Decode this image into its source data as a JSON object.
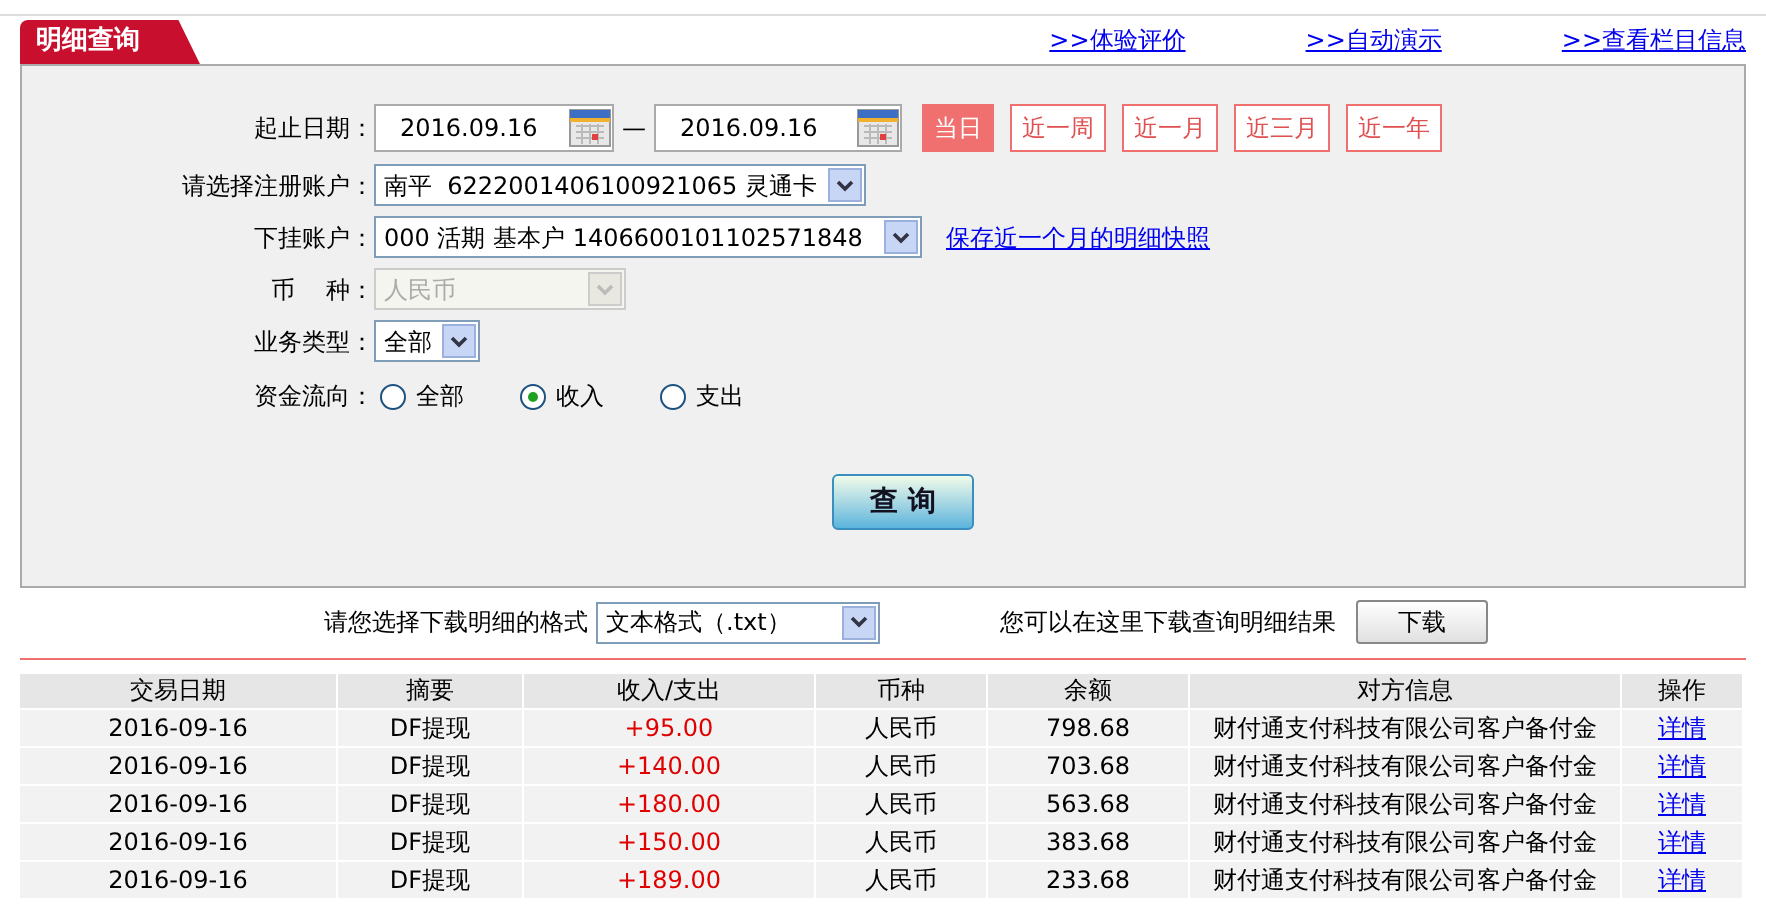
{
  "header": {
    "tab": "明细查询",
    "links": [
      ">>体验评价",
      ">>自动演示",
      ">>查看栏目信息"
    ]
  },
  "form": {
    "date_label": "起止日期：",
    "start_date": "2016.09.16",
    "separator": "—",
    "end_date": "2016.09.16",
    "quick_ranges": [
      {
        "label": "当日",
        "selected": true
      },
      {
        "label": "近一周",
        "selected": false
      },
      {
        "label": "近一月",
        "selected": false
      },
      {
        "label": "近三月",
        "selected": false
      },
      {
        "label": "近一年",
        "selected": false
      }
    ],
    "account": {
      "label": "请选择注册账户：",
      "value": "南平  6222001406100921065 灵通卡",
      "disabled": false
    },
    "sub_account": {
      "label": "下挂账户：",
      "value": "000 活期 基本户 1406600101102571848",
      "disabled": false,
      "link": "保存近一个月的明细快照"
    },
    "currency": {
      "label": "币    种：",
      "value": "人民币",
      "disabled": true
    },
    "business_type": {
      "label": "业务类型：",
      "value": "全部",
      "disabled": false
    },
    "flow": {
      "label": "资金流向：",
      "options": [
        {
          "label": "全部",
          "selected": false
        },
        {
          "label": "收入",
          "selected": true
        },
        {
          "label": "支出",
          "selected": false
        }
      ]
    },
    "query_button": "查 询"
  },
  "download": {
    "label": "请您选择下载明细的格式",
    "format": "文本格式（.txt）",
    "hint": "您可以在这里下载查询明细结果",
    "button": "下载"
  },
  "table": {
    "columns": [
      "交易日期",
      "摘要",
      "收入/支出",
      "币种",
      "余额",
      "对方信息",
      "操作"
    ],
    "rows": [
      [
        "2016-09-16",
        "DF提现",
        "+95.00",
        "人民币",
        "798.68",
        "财付通支付科技有限公司客户备付金",
        "详情"
      ],
      [
        "2016-09-16",
        "DF提现",
        "+140.00",
        "人民币",
        "703.68",
        "财付通支付科技有限公司客户备付金",
        "详情"
      ],
      [
        "2016-09-16",
        "DF提现",
        "+180.00",
        "人民币",
        "563.68",
        "财付通支付科技有限公司客户备付金",
        "详情"
      ],
      [
        "2016-09-16",
        "DF提现",
        "+150.00",
        "人民币",
        "383.68",
        "财付通支付科技有限公司客户备付金",
        "详情"
      ],
      [
        "2016-09-16",
        "DF提现",
        "+189.00",
        "人民币",
        "233.68",
        "财付通支付科技有限公司客户备付金",
        "详情"
      ]
    ]
  }
}
